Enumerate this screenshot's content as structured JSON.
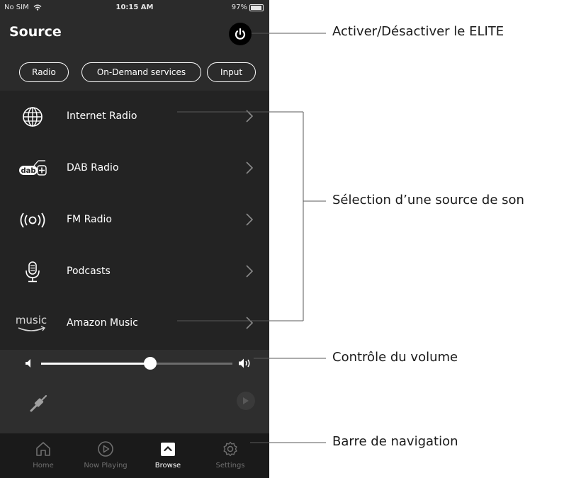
{
  "status_bar": {
    "carrier": "No SIM",
    "time": "10:15 AM",
    "battery": "97%"
  },
  "header": {
    "title": "Source"
  },
  "tabs": [
    {
      "label": "Radio"
    },
    {
      "label": "On-Demand services"
    },
    {
      "label": "Input"
    }
  ],
  "sources": [
    {
      "label": "Internet Radio",
      "icon": "globe-icon"
    },
    {
      "label": "DAB Radio",
      "icon": "dab-plus-icon"
    },
    {
      "label": "FM Radio",
      "icon": "fm-broadcast-icon"
    },
    {
      "label": "Podcasts",
      "icon": "microphone-icon"
    },
    {
      "label": "Amazon Music",
      "icon": "amazon-music-icon",
      "icon_text": "music"
    }
  ],
  "volume": {
    "level": 0.57
  },
  "nav": [
    {
      "label": "Home",
      "icon": "home-icon"
    },
    {
      "label": "Now Playing",
      "icon": "play-circle-icon"
    },
    {
      "label": "Browse",
      "icon": "browse-icon",
      "active": true
    },
    {
      "label": "Settings",
      "icon": "gear-icon"
    }
  ],
  "annotations": {
    "power": "Activer/Désactiver le ELITE",
    "source": "Sélection d’une source de son",
    "volume": "Contrôle du volume",
    "navigation": "Barre de navigation"
  },
  "colors": {
    "background": "#2b2b2b",
    "list": "#232323",
    "navbar": "#1a1a1a",
    "accent": "#ffffff"
  }
}
